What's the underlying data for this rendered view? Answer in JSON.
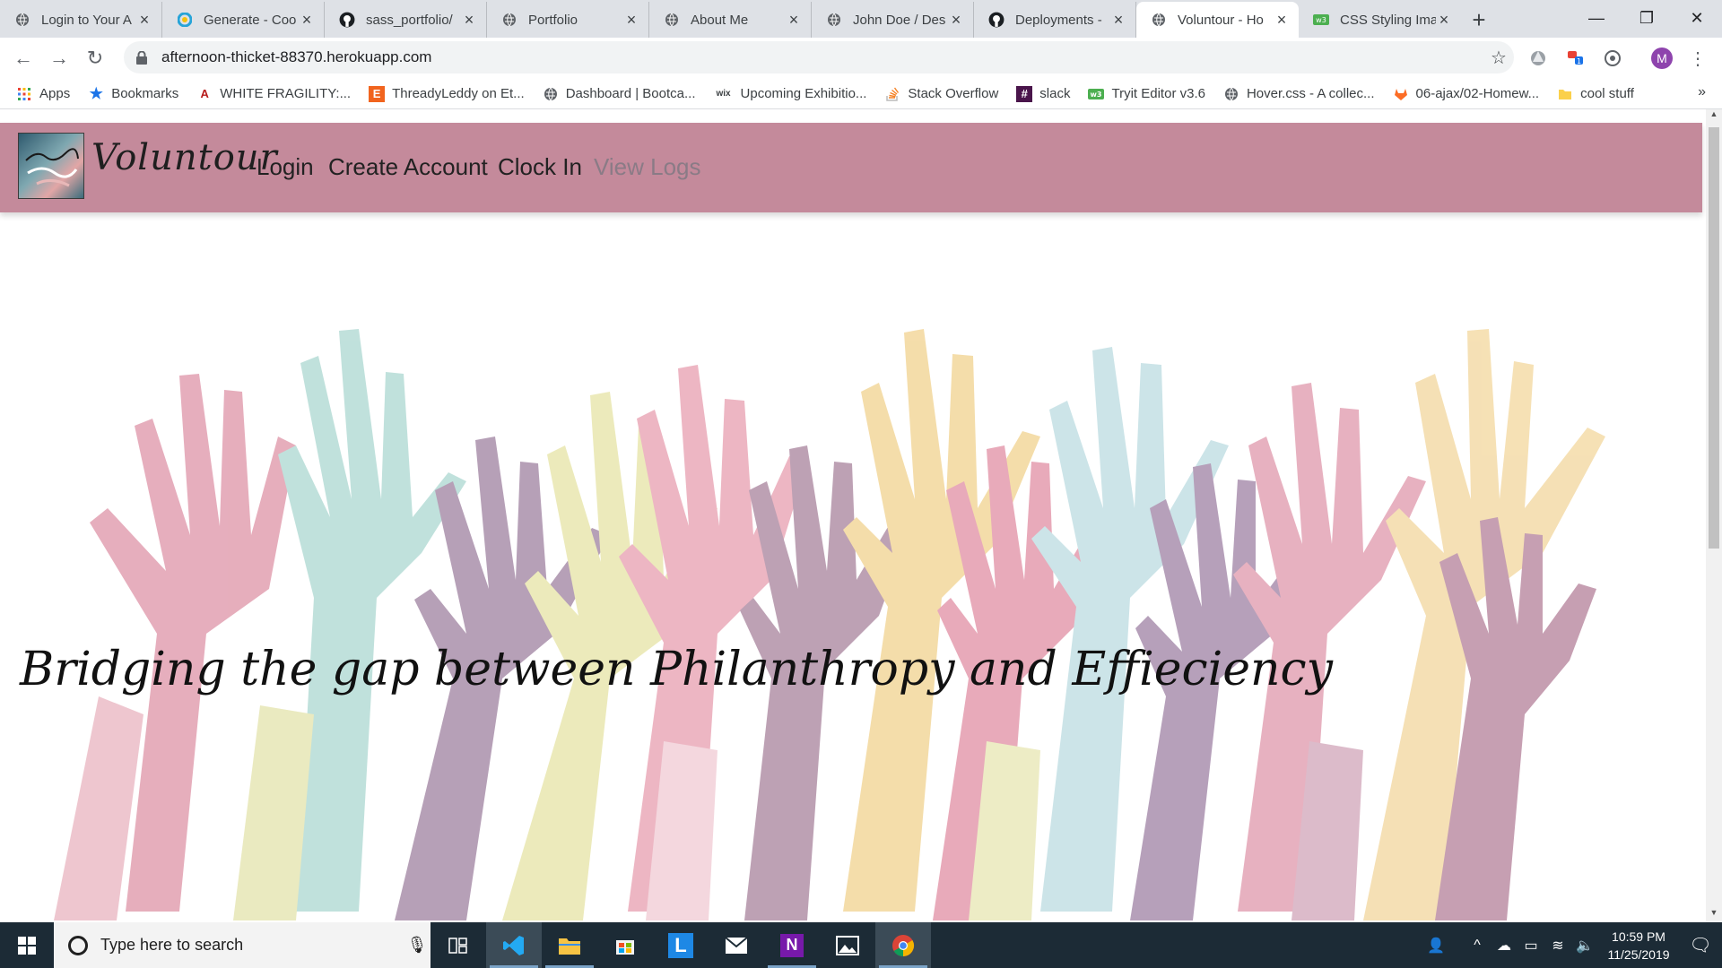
{
  "browser": {
    "tabs": [
      {
        "title": "Login to Your A",
        "icon": "globe-icon"
      },
      {
        "title": "Generate - Coo",
        "icon": "colorful-c-icon"
      },
      {
        "title": "sass_portfolio/",
        "icon": "github-icon"
      },
      {
        "title": "Portfolio",
        "icon": "globe-icon"
      },
      {
        "title": "About Me",
        "icon": "globe-icon"
      },
      {
        "title": "John Doe / Des",
        "icon": "globe-icon"
      },
      {
        "title": "Deployments -",
        "icon": "github-icon"
      },
      {
        "title": "Voluntour - Ho",
        "icon": "globe-icon",
        "active": true
      },
      {
        "title": "CSS Styling Ima",
        "icon": "w3-icon"
      }
    ],
    "new_tab_label": "+",
    "url": "afternoon-thicket-88370.herokuapp.com",
    "profile_initial": "M",
    "bookmarks": [
      {
        "label": "Apps",
        "icon": "apps-grid-icon"
      },
      {
        "label": "Bookmarks",
        "icon": "star-icon"
      },
      {
        "label": "WHITE FRAGILITY:...",
        "icon": "a-logo-icon"
      },
      {
        "label": "ThreadyLeddy on Et...",
        "icon": "etsy-icon"
      },
      {
        "label": "Dashboard | Bootca...",
        "icon": "globe-icon"
      },
      {
        "label": "Upcoming Exhibitio...",
        "icon": "wix-icon"
      },
      {
        "label": "Stack Overflow",
        "icon": "stackoverflow-icon"
      },
      {
        "label": "slack",
        "icon": "slack-icon"
      },
      {
        "label": "Tryit Editor v3.6",
        "icon": "w3-icon"
      },
      {
        "label": "Hover.css - A collec...",
        "icon": "globe-icon"
      },
      {
        "label": "06-ajax/02-Homew...",
        "icon": "gitlab-icon"
      },
      {
        "label": "cool stuff",
        "icon": "folder-icon"
      }
    ],
    "bookmarks_more": "»"
  },
  "site": {
    "brand": "Voluntour",
    "nav": [
      {
        "label": "Login"
      },
      {
        "label": "Create Account"
      },
      {
        "label": "Clock In"
      },
      {
        "label": "View Logs"
      }
    ],
    "tagline": "Bridging the gap between Philanthropy and Effieciency",
    "colors": {
      "navbar": "#c48a9b",
      "muted_link": "#8a7b86"
    }
  },
  "taskbar": {
    "search_placeholder": "Type here to search",
    "time": "10:59 PM",
    "date": "11/25/2019",
    "pinned_apps": [
      "task-view-icon",
      "vscode-icon",
      "file-explorer-icon",
      "store-icon",
      "l-app-icon",
      "mail-icon",
      "onenote-icon",
      "photos-icon",
      "chrome-icon"
    ]
  }
}
